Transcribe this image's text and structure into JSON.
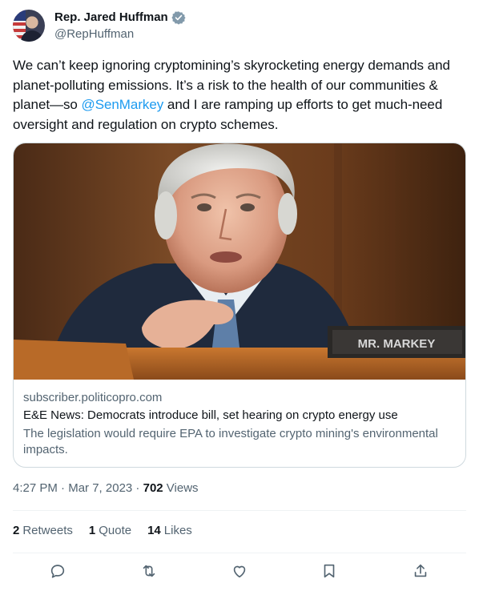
{
  "author": {
    "name": "Rep. Jared Huffman",
    "handle": "@RepHuffman"
  },
  "tweet": {
    "text_before": "We can’t keep ignoring cryptomining’s skyrocketing energy demands and planet-polluting emissions. It’s a risk to the health of our communities & planet—so ",
    "mention": "@SenMarkey",
    "text_after": " and I are ramping up efforts to get much-need oversight and regulation on crypto schemes."
  },
  "card": {
    "nameplate": "MR. MARKEY",
    "domain": "subscriber.politicopro.com",
    "title": "E&E News: Democrats introduce bill, set hearing on crypto energy use",
    "description": "The legislation would require EPA to investigate crypto mining's environmental impacts."
  },
  "meta": {
    "time": "4:27 PM",
    "separator": " · ",
    "date": "Mar 7, 2023",
    "views_count": "702",
    "views_label": " Views"
  },
  "stats": {
    "retweets_count": "2",
    "retweets_label": "Retweets",
    "quotes_count": "1",
    "quotes_label": "Quote",
    "likes_count": "14",
    "likes_label": "Likes"
  },
  "colors": {
    "link": "#1d9bf0",
    "secondary_text": "#536471",
    "border": "#cfd9de"
  },
  "icons": [
    "verified-badge-icon",
    "reply-icon",
    "retweet-icon",
    "like-icon",
    "bookmark-icon",
    "share-icon"
  ]
}
